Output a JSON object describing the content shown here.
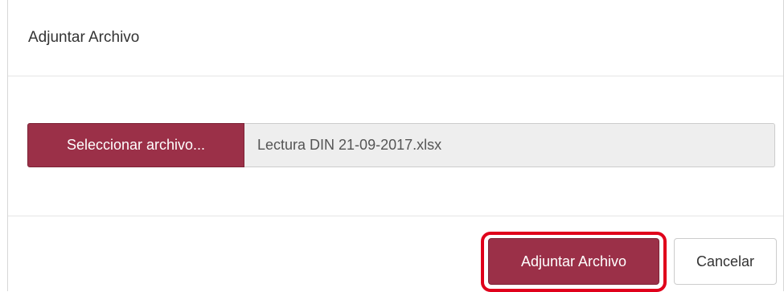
{
  "modal": {
    "title": "Adjuntar Archivo"
  },
  "file_input": {
    "button_label": "Seleccionar archivo...",
    "file_name": "Lectura DIN 21-09-2017.xlsx"
  },
  "footer": {
    "submit_label": "Adjuntar Archivo",
    "cancel_label": "Cancelar"
  },
  "colors": {
    "primary": "#9b3048",
    "highlight": "#e0001b"
  }
}
